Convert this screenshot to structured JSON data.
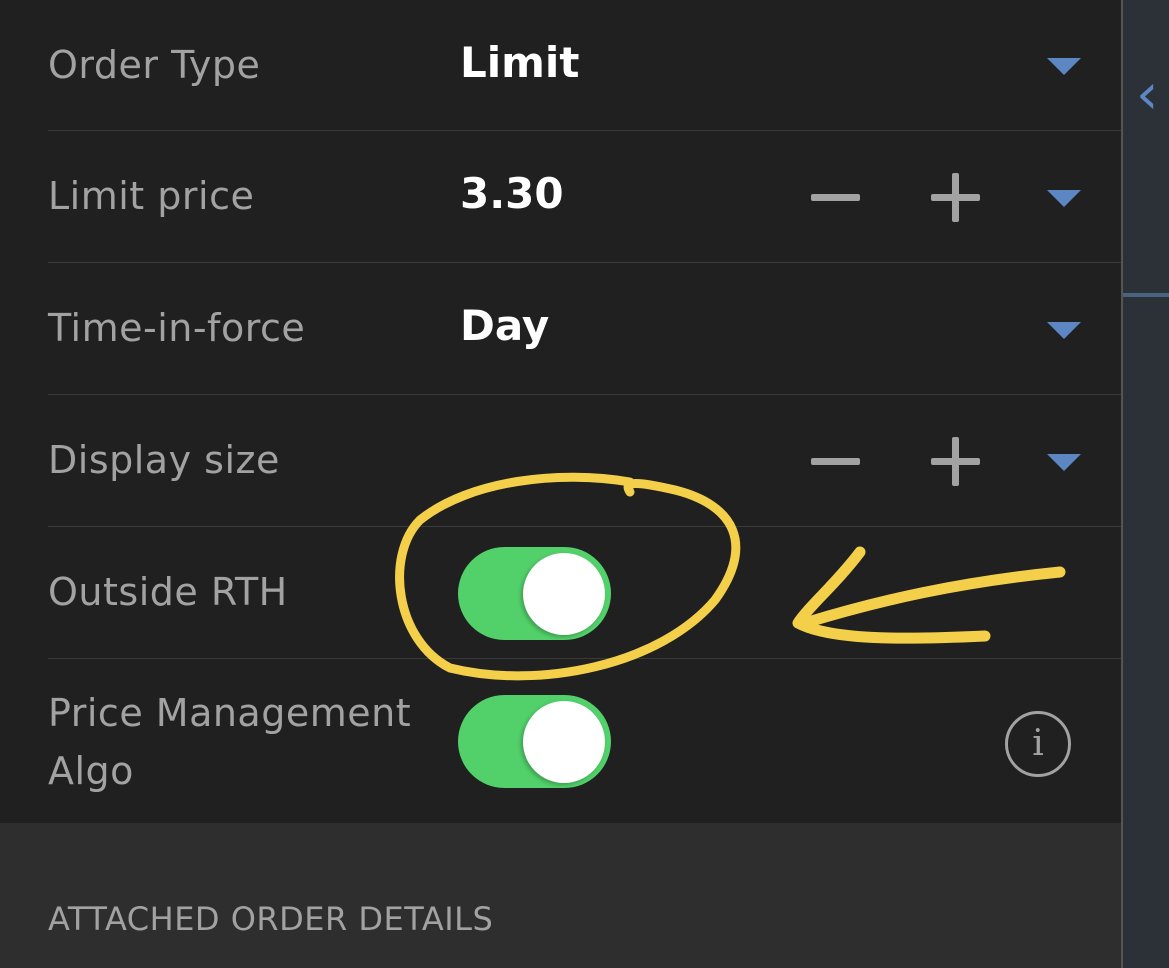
{
  "rows": {
    "order_type": {
      "label": "Order Type",
      "value": "Limit"
    },
    "limit_price": {
      "label": "Limit price",
      "value": "3.30"
    },
    "time_in_force": {
      "label": "Time-in-force",
      "value": "Day"
    },
    "display_size": {
      "label": "Display size"
    },
    "outside_rth": {
      "label": "Outside RTH",
      "on": true
    },
    "price_mgmt": {
      "label_line1": "Price Management",
      "label_line2": "Algo",
      "on": true
    }
  },
  "section": {
    "title": "ATTACHED ORDER DETAILS"
  },
  "side_panel": {
    "chevron": "‹"
  },
  "icons": {
    "dropdown": "caret-down-icon",
    "decrement": "minus-icon",
    "increment": "plus-icon",
    "info": "info-icon",
    "info_glyph": "i"
  },
  "colors": {
    "accent": "#5c87c2",
    "toggle_on": "#52d16a",
    "annotation": "#f4d04a",
    "background": "#202020"
  }
}
